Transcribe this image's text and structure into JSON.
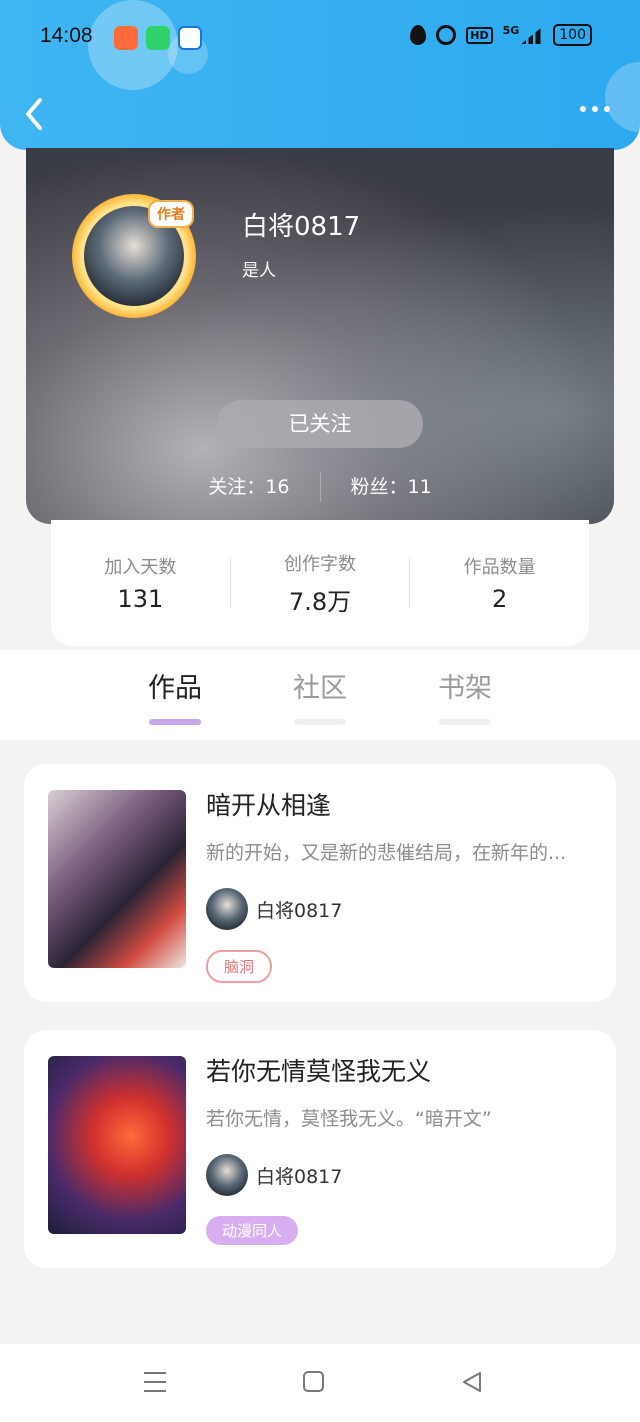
{
  "status_bar": {
    "time": "14:08",
    "hd": "HD",
    "network": "5G",
    "battery": "100"
  },
  "profile": {
    "author_badge": "作者",
    "username": "白将0817",
    "bio": "是人",
    "follow_button": "已关注",
    "following": "关注：16",
    "followers": "粉丝：11"
  },
  "stats": [
    {
      "label": "加入天数",
      "value": "131"
    },
    {
      "label": "创作字数",
      "value": "7.8万"
    },
    {
      "label": "作品数量",
      "value": "2"
    }
  ],
  "tabs": [
    {
      "label": "作品",
      "active": true
    },
    {
      "label": "社区",
      "active": false
    },
    {
      "label": "书架",
      "active": false
    }
  ],
  "works": [
    {
      "title": "暗开从相逢",
      "description": "新的开始，又是新的悲催结局，在新年的...",
      "author": "白将0817",
      "tag": "脑洞"
    },
    {
      "title": "若你无情莫怪我无义",
      "description": "若你无情，莫怪我无义。“暗开文”",
      "author": "白将0817",
      "tag": "动漫同人"
    }
  ],
  "colors": {
    "header": "#2da9f0",
    "tab_active": "#c8a7eb",
    "tag_outline": "#e07a7e",
    "tag_fill": "#d8aef0"
  }
}
